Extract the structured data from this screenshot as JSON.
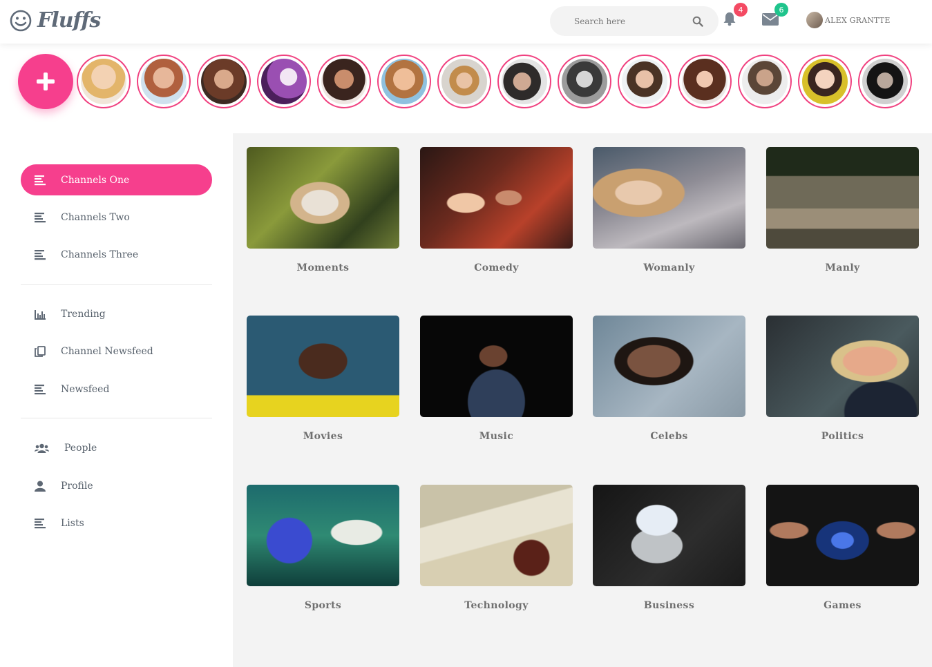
{
  "header": {
    "logo_text": "Fluffs",
    "search_placeholder": "Search here",
    "notifications_count": "4",
    "messages_count": "6",
    "user_name": "ALEX GRANTTE"
  },
  "colors": {
    "accent": "#f63f8d",
    "notification_badge": "#f44a63",
    "message_badge": "#1fc48c",
    "sidebar_text": "#555f6a",
    "main_bg": "#f3f3f3"
  },
  "stories": {
    "add_icon": "plus-icon",
    "count": 14
  },
  "sidebar": {
    "group1": [
      {
        "label": "Channels One",
        "icon": "list-icon",
        "active": true
      },
      {
        "label": "Channels Two",
        "icon": "list-icon"
      },
      {
        "label": "Channels Three",
        "icon": "list-icon"
      }
    ],
    "group2": [
      {
        "label": "Trending",
        "icon": "bar-chart-icon"
      },
      {
        "label": "Channel Newsfeed",
        "icon": "copy-icon"
      },
      {
        "label": "Newsfeed",
        "icon": "list-icon"
      }
    ],
    "group3": [
      {
        "label": "People",
        "icon": "users-icon"
      },
      {
        "label": "Profile",
        "icon": "user-icon"
      },
      {
        "label": "Lists",
        "icon": "list-icon"
      }
    ]
  },
  "channels": [
    {
      "label": "Moments"
    },
    {
      "label": "Comedy"
    },
    {
      "label": "Womanly"
    },
    {
      "label": "Manly"
    },
    {
      "label": "Movies"
    },
    {
      "label": "Music"
    },
    {
      "label": "Celebs"
    },
    {
      "label": "Politics"
    },
    {
      "label": "Sports"
    },
    {
      "label": "Technology"
    },
    {
      "label": "Business"
    },
    {
      "label": "Games"
    }
  ]
}
